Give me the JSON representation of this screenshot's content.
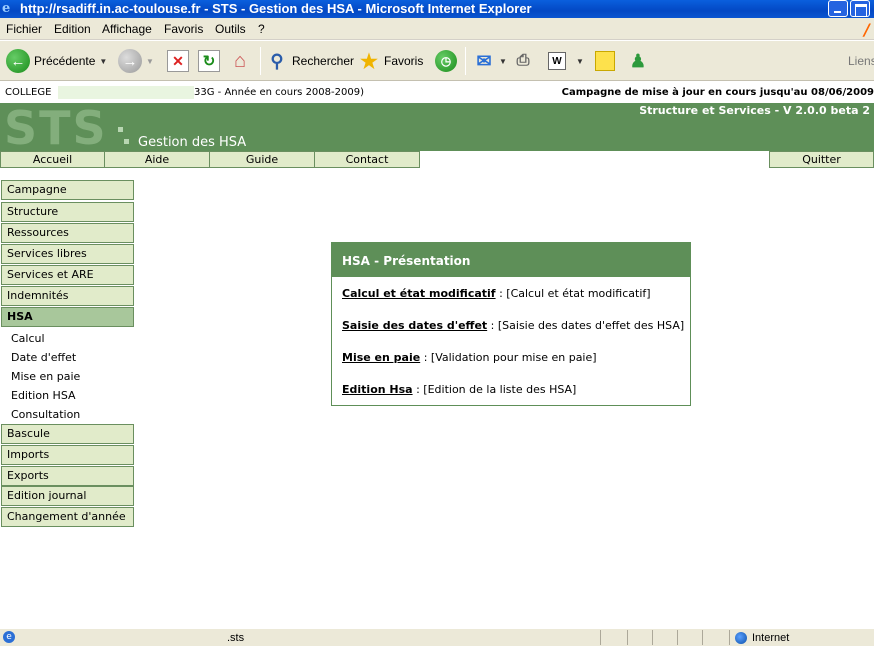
{
  "window": {
    "title": "http://rsadiff.in.ac-toulouse.fr - STS - Gestion des HSA - Microsoft Internet Explorer"
  },
  "menu": [
    "Fichier",
    "Edition",
    "Affichage",
    "Favoris",
    "Outils",
    "?"
  ],
  "toolbar": {
    "back_label": "Précédente",
    "search_label": "Rechercher",
    "favorites_label": "Favoris",
    "links_label": "Liens"
  },
  "info": {
    "college_label": "COLLEGE",
    "year_text": "33G - Année en cours 2008-2009)",
    "campaign": "Campagne de mise à jour en cours jusqu'au 08/06/2009"
  },
  "banner": {
    "logo_text": "STS",
    "app_title": "Gestion des HSA",
    "version": "Structure et Services - V 2.0.0 beta 2"
  },
  "nav": {
    "tabs": [
      "Accueil",
      "Aide",
      "Guide",
      "Contact"
    ],
    "quit": "Quitter"
  },
  "sidebar": {
    "items_top": [
      "Campagne",
      "Structure",
      "Ressources",
      "Services libres",
      "Services et ARE",
      "Indemnités"
    ],
    "active": "HSA",
    "sub_items": [
      "Calcul",
      "Date d'effet",
      "Mise en paie",
      "Edition HSA",
      "Consultation"
    ],
    "items_bottom": [
      "Bascule",
      "Imports",
      "Exports",
      "Edition journal",
      "Changement d'année"
    ]
  },
  "panel": {
    "title": "HSA - Présentation",
    "rows": [
      {
        "link": "Calcul et état modificatif",
        "desc": " : [Calcul et état modificatif]"
      },
      {
        "link": "Saisie des dates d'effet",
        "desc": " : [Saisie des dates d'effet des HSA]"
      },
      {
        "link": "Mise en paie",
        "desc": " : [Validation pour mise en paie]"
      },
      {
        "link": "Edition Hsa",
        "desc": " : [Edition de la liste des HSA]"
      }
    ]
  },
  "status": {
    "message": ".sts",
    "zone": "Internet"
  }
}
